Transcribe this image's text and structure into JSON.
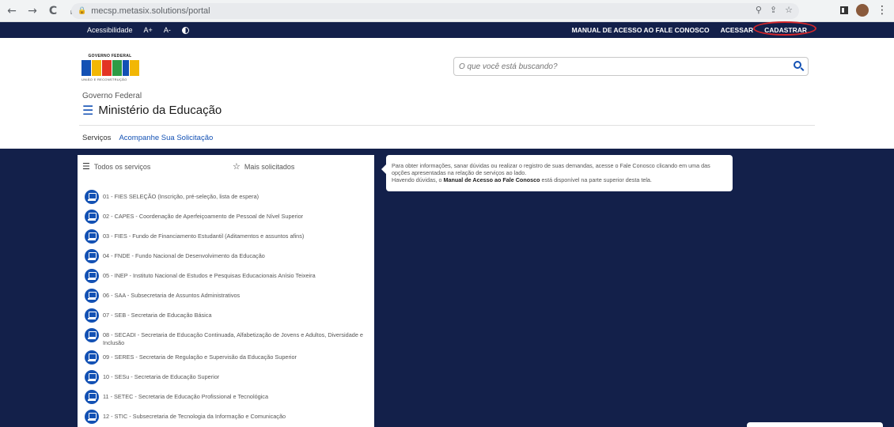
{
  "browser": {
    "url": "mecsp.metasix.solutions/portal",
    "back_icon": "←",
    "forward_icon": "→",
    "reload_icon": "C",
    "home_icon": "⌂",
    "lock_icon": "🔒",
    "zoom_icon": "⚲",
    "share_icon": "⇪",
    "star_icon": "☆",
    "more_icon": "⋮"
  },
  "topbar": {
    "accessibility": "Acessibilidade",
    "font_increase": "A+",
    "font_decrease": "A-",
    "manual": "MANUAL DE ACESSO AO FALE CONOSCO",
    "access": "ACESSAR",
    "register": "CADASTRAR"
  },
  "header": {
    "logo_top": "GOVERNO FEDERAL",
    "logo_word": "BRASIL",
    "logo_bottom": "UNIÃO E RECONSTRUÇÃO",
    "government": "Governo Federal",
    "ministry": "Ministério da Educação",
    "menu_icon": "☰",
    "search_placeholder": "O que você está buscando?"
  },
  "subnav": {
    "services": "Serviços",
    "track": "Acompanhe Sua Solicitação"
  },
  "panel": {
    "all_services": "Todos os serviços",
    "most_requested": "Mais solicitados",
    "list_icon": "☰",
    "star_icon": "☆",
    "services": [
      "01 - FIES SELEÇÃO (Inscrição, pré-seleção, lista de espera)",
      "02 - CAPES - Coordenação de Aperfeiçoamento de Pessoal de Nível Superior",
      "03 - FIES - Fundo de Financiamento Estudantil (Aditamentos e assuntos afins)",
      "04 - FNDE - Fundo Nacional de Desenvolvimento da Educação",
      "05 - INEP - Instituto Nacional de Estudos e Pesquisas Educacionais Anísio Teixeira",
      "06 - SAA - Subsecretaria de Assuntos Administrativos",
      "07 - SEB - Secretaria de Educação Básica",
      "08 - SECADI - Secretaria de Educação Continuada, Alfabetização de Jovens e Adultos, Diversidade e Inclusão",
      "09 - SERES - Secretaria de Regulação e Supervisão da Educação Superior",
      "10 - SESu - Secretaria de Educação Superior",
      "11 - SETEC - Secretaria de Educação Profissional e Tecnológica",
      "12 - STIC - Subsecretaria de Tecnologia da Informação e Comunicação"
    ]
  },
  "info": {
    "line1": "Para obter informações, sanar dúvidas ou realizar o registro de suas demandas, acesse o Fale Conosco clicando em uma das opções apresentadas na relação de serviços ao lado.",
    "line2_pre": "Havendo dúvidas, o ",
    "line2_bold": "Manual de Acesso ao Fale Conosco",
    "line2_post": " está disponível na parte superior desta tela."
  },
  "colors": {
    "navy": "#13204a",
    "gov_blue": "#1351b4",
    "highlight_red": "#d3262b"
  }
}
